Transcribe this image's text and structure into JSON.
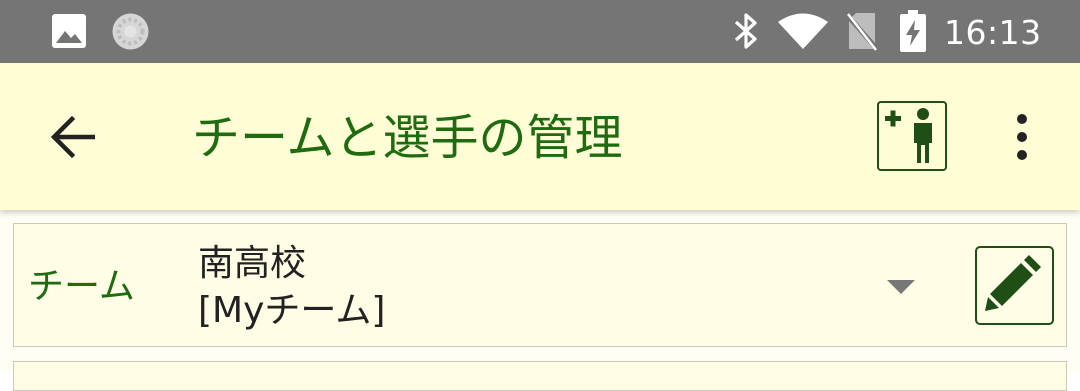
{
  "status_bar": {
    "time": "16:13",
    "icons": [
      "image-notification-icon",
      "sync-spinner-icon",
      "bluetooth-icon",
      "wifi-icon",
      "no-sim-icon",
      "battery-charging-icon"
    ]
  },
  "app_bar": {
    "title": "チームと選手の管理",
    "icons": [
      "back-arrow-icon",
      "add-player-icon",
      "more-vert-icon"
    ]
  },
  "team_selector": {
    "label": "チーム",
    "selected_team": "南高校",
    "selected_team_tag": "[Myチーム]",
    "icons": [
      "dropdown-arrow-icon",
      "pencil-icon"
    ]
  },
  "colors": {
    "status_bar_bg": "#757575",
    "app_bar_bg": "#fffdd6",
    "accent_green": "#1e6b10",
    "icon_dark_green": "#1f4f16",
    "row_bg": "#fffde6"
  }
}
